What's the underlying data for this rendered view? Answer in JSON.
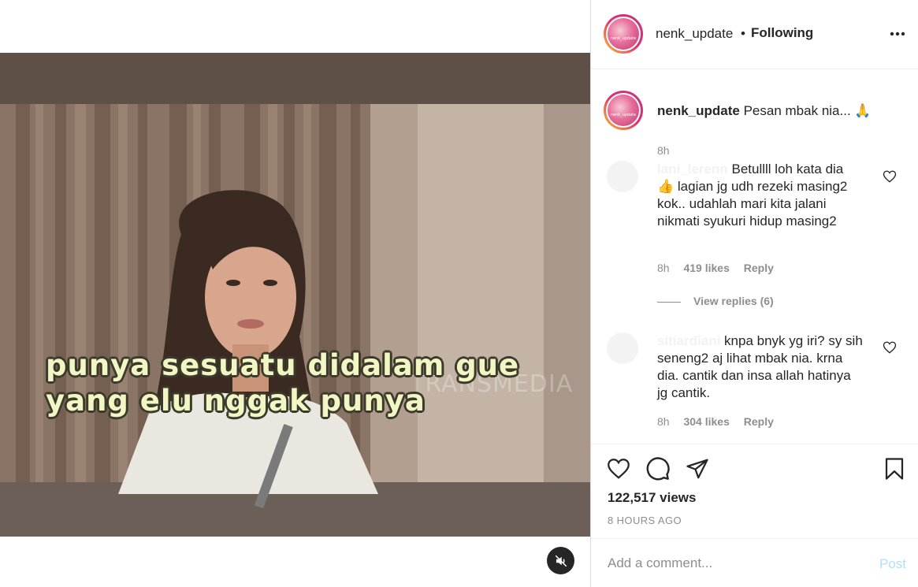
{
  "post": {
    "username": "nenk_update",
    "separator": "•",
    "follow_state": "Following",
    "avatar_text": "nenk_update"
  },
  "video": {
    "caption_line1": "punya sesuatu  didalam gue",
    "caption_line2": "yang elu nggak punya",
    "watermark": "TRANSMEDIA"
  },
  "caption": {
    "username": "nenk_update",
    "text": "Pesan mbak nia... 🙏",
    "time": "8h"
  },
  "comments": [
    {
      "user": "lani_lerenn",
      "text": "Betullll loh kata dia 👍 lagian jg udh rezeki masing2 kok.. udahlah mari kita jalani nikmati syukuri hidup masing2",
      "time": "8h",
      "likes": "419 likes",
      "reply": "Reply",
      "view_replies": "View replies (6)"
    },
    {
      "user": "sitiardiani",
      "text": "knpa bnyk yg iri? sy sih seneng2 aj lihat mbak nia. krna dia. cantik dan insa allah hatinya jg cantik.",
      "time": "8h",
      "likes": "304 likes",
      "reply": "Reply"
    }
  ],
  "stats": {
    "views": "122,517 views",
    "time_ago": "8 HOURS AGO"
  },
  "composer": {
    "placeholder": "Add a comment...",
    "post_label": "Post"
  },
  "colors": {
    "text": "#262626",
    "secondary": "#8e8e8e",
    "post_disabled": "#b2dffc",
    "border": "#dbdbdb"
  },
  "icons": [
    "more-icon",
    "heart-icon",
    "comment-icon",
    "share-icon",
    "bookmark-icon",
    "mute-icon",
    "small-heart-icon"
  ]
}
